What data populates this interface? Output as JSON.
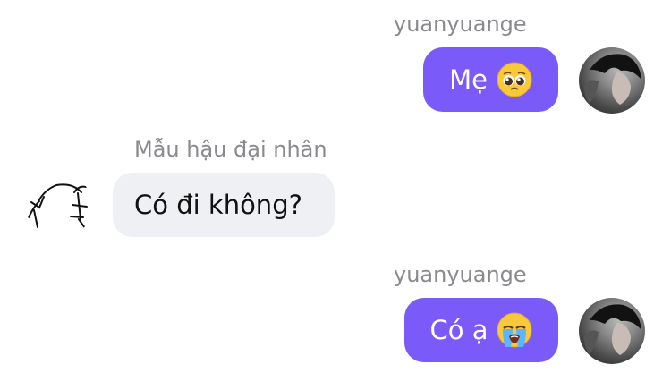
{
  "messages": [
    {
      "sender": "yuanyuange",
      "direction": "outgoing",
      "text": "Mẹ",
      "emoji": "pleading-face-emoji",
      "avatar": "user-photo-avatar"
    },
    {
      "sender": "Mẫu hậu đại nhân",
      "direction": "incoming",
      "text": "Có đi không?",
      "avatar": "sketch-avatar"
    },
    {
      "sender": "yuanyuange",
      "direction": "outgoing",
      "text": "Có ạ",
      "emoji": "loudly-crying-face-emoji",
      "avatar": "user-photo-avatar"
    }
  ],
  "colors": {
    "outgoing_bubble": "#7a5af8",
    "incoming_bubble": "#eef0f3",
    "sender_name": "#8a8a8e"
  }
}
